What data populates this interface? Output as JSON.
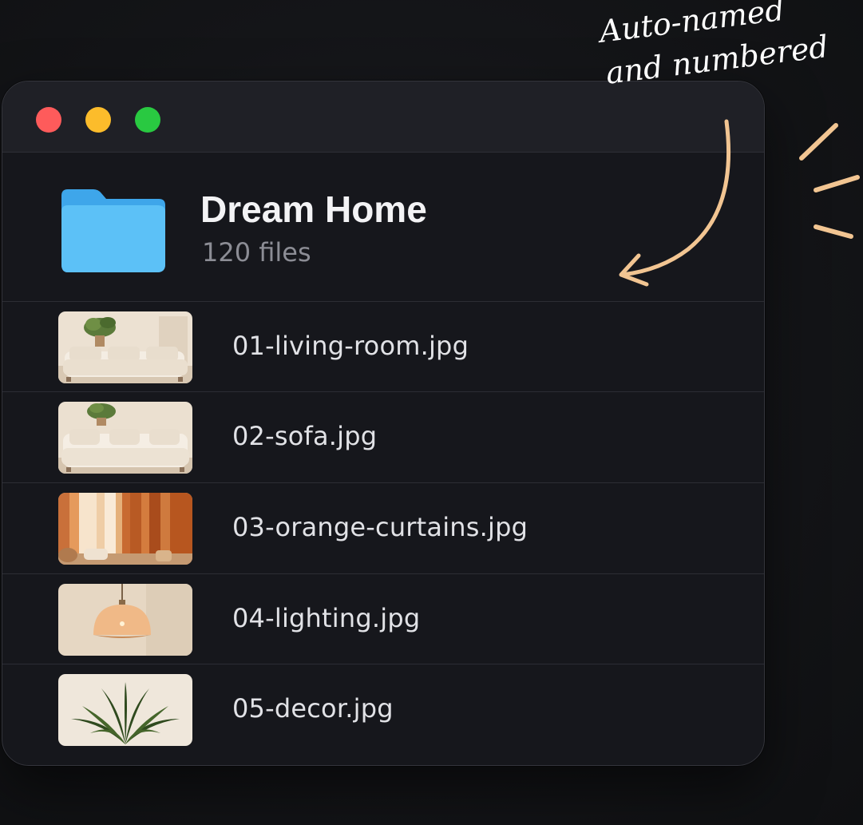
{
  "window": {
    "controls": [
      "close",
      "minimize",
      "zoom"
    ]
  },
  "folder": {
    "title": "Dream Home",
    "count": "120 files",
    "icon": "folder-icon",
    "color": "#5cc1f7"
  },
  "files": [
    {
      "name": "01-living-room.jpg",
      "thumbnail": "living-room"
    },
    {
      "name": "02-sofa.jpg",
      "thumbnail": "sofa"
    },
    {
      "name": "03-orange-curtains.jpg",
      "thumbnail": "orange-curtains"
    },
    {
      "name": "04-lighting.jpg",
      "thumbnail": "pendant-lamp"
    },
    {
      "name": "05-decor.jpg",
      "thumbnail": "plant-decor"
    }
  ],
  "annotation": {
    "line1": "Auto-named",
    "line2": "and numbered",
    "accent": "#f2c592"
  }
}
